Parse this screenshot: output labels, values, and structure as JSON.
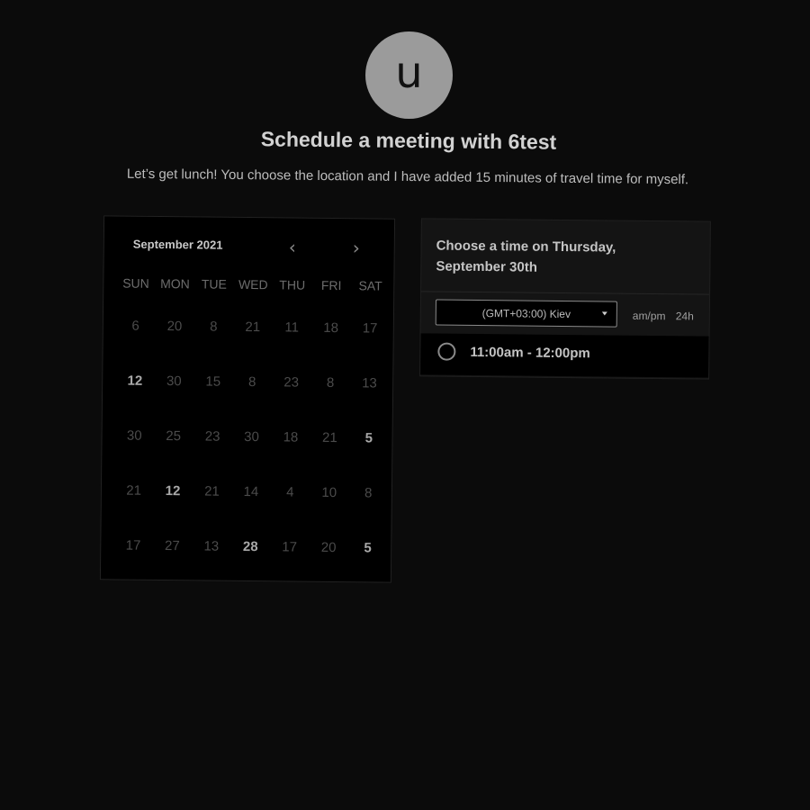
{
  "host": {
    "avatar_letter": "u",
    "title": "Schedule a meeting with 6test",
    "description": "Let’s get lunch! You choose the location and I have added 15 minutes of travel time for myself."
  },
  "calendar": {
    "month": "September 2021",
    "prev_icon": "chevron-left-icon",
    "next_icon": "chevron-right-icon",
    "weekdays": [
      "SUN",
      "MON",
      "TUE",
      "WED",
      "THU",
      "FRI",
      "SAT"
    ],
    "weeks": [
      [
        {
          "d": "6",
          "a": false
        },
        {
          "d": "20",
          "a": false
        },
        {
          "d": "8",
          "a": false
        },
        {
          "d": "21",
          "a": false
        },
        {
          "d": "11",
          "a": false
        },
        {
          "d": "18",
          "a": false
        },
        {
          "d": "17",
          "a": false
        }
      ],
      [
        {
          "d": "12",
          "a": true
        },
        {
          "d": "30",
          "a": false
        },
        {
          "d": "15",
          "a": false
        },
        {
          "d": "8",
          "a": false
        },
        {
          "d": "23",
          "a": false
        },
        {
          "d": "8",
          "a": false
        },
        {
          "d": "13",
          "a": false
        }
      ],
      [
        {
          "d": "30",
          "a": false
        },
        {
          "d": "25",
          "a": false
        },
        {
          "d": "23",
          "a": false
        },
        {
          "d": "30",
          "a": false
        },
        {
          "d": "18",
          "a": false
        },
        {
          "d": "21",
          "a": false
        },
        {
          "d": "5",
          "a": true
        }
      ],
      [
        {
          "d": "21",
          "a": false
        },
        {
          "d": "12",
          "a": true
        },
        {
          "d": "21",
          "a": false
        },
        {
          "d": "14",
          "a": false
        },
        {
          "d": "4",
          "a": false
        },
        {
          "d": "10",
          "a": false
        },
        {
          "d": "8",
          "a": false
        }
      ],
      [
        {
          "d": "17",
          "a": false
        },
        {
          "d": "27",
          "a": false
        },
        {
          "d": "13",
          "a": false
        },
        {
          "d": "28",
          "a": true
        },
        {
          "d": "17",
          "a": false
        },
        {
          "d": "20",
          "a": false
        },
        {
          "d": "5",
          "a": true
        }
      ]
    ]
  },
  "times": {
    "heading": "Choose a time on Thursday, September 30th",
    "timezone": "(GMT+03:00) Kiev",
    "format_ampm": "am/pm",
    "format_24h": "24h",
    "slots": [
      "11:00am - 12:00pm"
    ]
  }
}
